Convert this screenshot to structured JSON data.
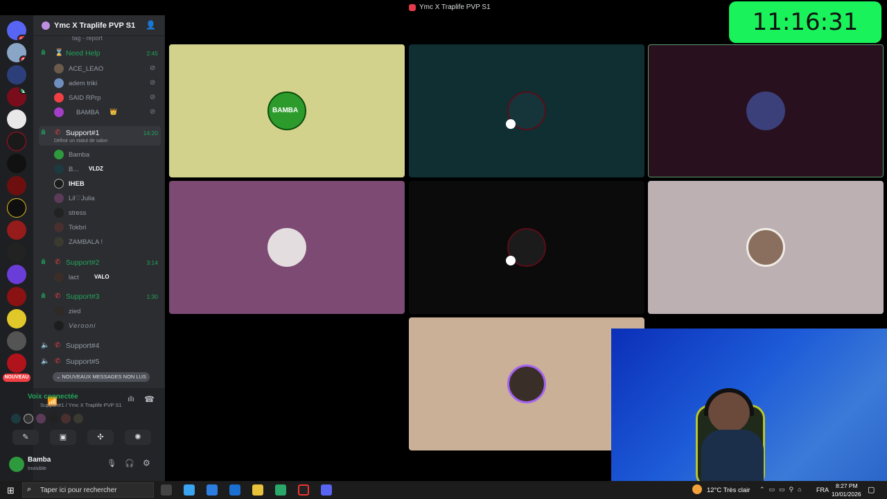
{
  "window": {
    "title": "Ymc X Traplife PVP S1"
  },
  "clock": {
    "time": "11:16:31"
  },
  "server": {
    "name": "Ymc X Traplife PVP S1",
    "truncated_item": "tag - report"
  },
  "rail": {
    "badge_top": "1K+",
    "badge_1": "1",
    "badge_2": "1",
    "new_pill": "NOUVEAU"
  },
  "channels": {
    "need_help": {
      "name": "Need Help",
      "time": "2:45",
      "users": [
        "ACE_LEAO",
        "adem triki",
        "SAID RPrp",
        "BAMBA"
      ]
    },
    "support1": {
      "name": "Support#1",
      "time": "14:20",
      "status": "Définir un statut de salon",
      "users": [
        "Bamba",
        "B...",
        "IHEB",
        "Lil♡Julia",
        "stress",
        "Tokbri",
        "ZAMBALA !"
      ],
      "user_tag": "VLDZ"
    },
    "support2": {
      "name": "Support#2",
      "time": "3:14",
      "users": [
        "lact"
      ],
      "user_tag": "VALO"
    },
    "support3": {
      "name": "Support#3",
      "time": "1:30",
      "users": [
        "zied",
        "Verooni"
      ]
    },
    "support4": {
      "name": "Support#4"
    },
    "support5": {
      "name": "Support#5"
    },
    "unread_pill": "NOUVEAUX MESSAGES NON LUS"
  },
  "voice": {
    "status": "Voix connectée",
    "location": "Support#1 / Ymc X Traplife PVP S1"
  },
  "me": {
    "name": "Bamba",
    "status": "Invisible"
  },
  "tiles": [
    {
      "bg": "#d3d28c",
      "avatar_text": "BAMBA"
    },
    {
      "bg": "#0f2f33"
    },
    {
      "bg": "#28101f"
    },
    {
      "bg": "#7c4a72"
    },
    {
      "bg": "#0b0b0b"
    },
    {
      "bg": "#bcb0b3"
    },
    {
      "bg": "#c9b096"
    }
  ],
  "taskbar": {
    "search_placeholder": "Taper ici pour rechercher",
    "weather": "12°C  Très clair",
    "lang": "FRA",
    "time": "8:27 PM",
    "date": "10/01/2026"
  },
  "colors": {
    "accent": "#19f25a",
    "green": "#23a55a",
    "red": "#f23f43"
  }
}
